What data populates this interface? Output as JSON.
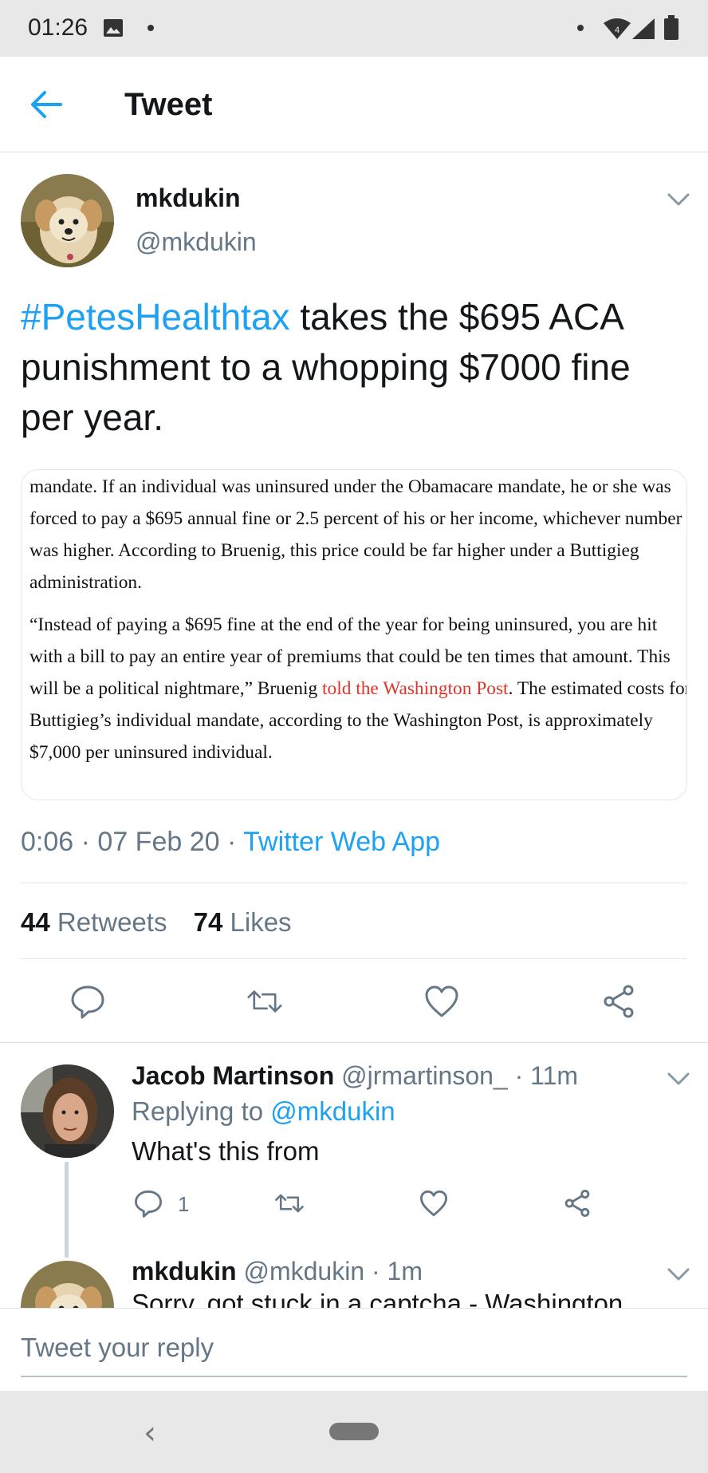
{
  "status_bar": {
    "time": "01:26",
    "icons": [
      "image-icon",
      "dot-icon",
      "dot-icon",
      "wifi-icon",
      "signal-icon",
      "battery-icon"
    ]
  },
  "header": {
    "title": "Tweet",
    "back_icon": "arrow-left-icon"
  },
  "tweet": {
    "author_name": "mkdukin",
    "author_handle": "@mkdukin",
    "hashtag": "#PetesHealthtax",
    "text": " takes the $695 ACA punishment to a whopping $7000 fine per year.",
    "media": {
      "paragraph1": "mandate. If an individual was uninsured under the Obamacare mandate, he or she was forced to pay a $695 annual fine or 2.5 percent of his or her income, whichever number was higher. According to Bruenig, this price could be far higher under a Buttigieg administration.",
      "paragraph2_before": "“Instead of paying a $695 fine at the end of the year for being uninsured, you are hit with a bill to pay an entire year of premiums that could be ten times that amount. This will be a political nightmare,” Bruenig ",
      "paragraph2_link": "told the Washington Post",
      "paragraph2_after": ". The estimated costs for Buttigieg’s individual mandate, according to the Washington Post, is approximately $7,000 per uninsured individual."
    },
    "time": "0:06",
    "date": "07 Feb 20",
    "separator": " · ",
    "app": "Twitter Web App",
    "retweets_count": "44",
    "retweets_label": " Retweets",
    "likes_count": "74",
    "likes_label": " Likes",
    "actions": [
      "reply-icon",
      "retweet-icon",
      "like-icon",
      "share-icon"
    ]
  },
  "replies": [
    {
      "name": "Jacob Martinson",
      "handle_time": " @jrmartinson_ · 11m",
      "replying_prefix": "Replying to ",
      "replying_to": "@mkdukin",
      "text": "What's this from",
      "reply_count": "1"
    },
    {
      "name": "mkdukin",
      "handle_time": " @mkdukin · 1m",
      "text": "Sorry, got stuck in a captcha - Washington"
    }
  ],
  "reply_box": {
    "placeholder": "Tweet your reply"
  },
  "nav_bar": {
    "back_glyph": "‹"
  },
  "colors": {
    "accent": "#1da1f2",
    "secondary_text": "#657786",
    "link_red": "#e0342a"
  }
}
